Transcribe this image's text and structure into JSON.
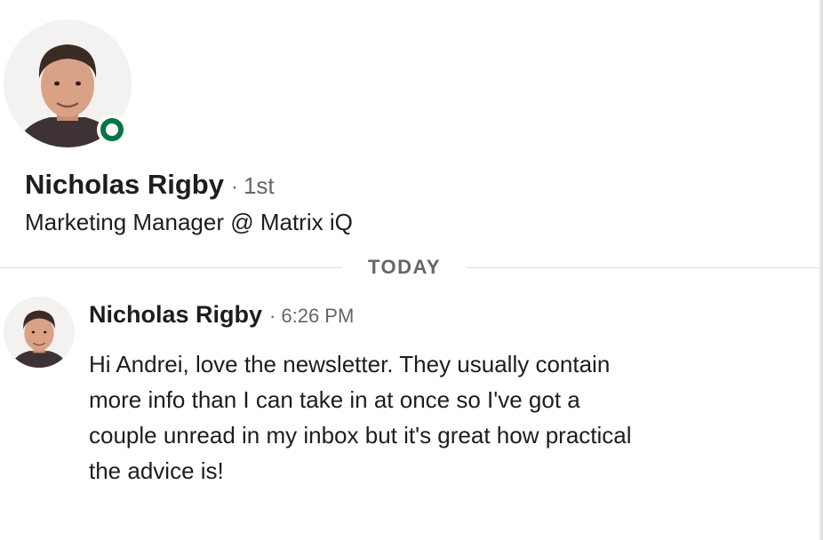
{
  "profile": {
    "avatar_icon": "profile-photo",
    "presence_status_color": "#057642",
    "name": "Nicholas Rigby",
    "degree_separator": "·",
    "degree": "1st",
    "headline": "Marketing Manager @ Matrix iQ"
  },
  "divider": {
    "label": "TODAY"
  },
  "message": {
    "sender": "Nicholas Rigby",
    "separator": "·",
    "time": "6:26 PM",
    "body_lines": [
      "Hi Andrei, love the newsletter. They usually contain",
      "more info than I can take in at once so I've got a",
      "couple unread in my inbox but it's great how practical",
      "the advice is!"
    ]
  }
}
